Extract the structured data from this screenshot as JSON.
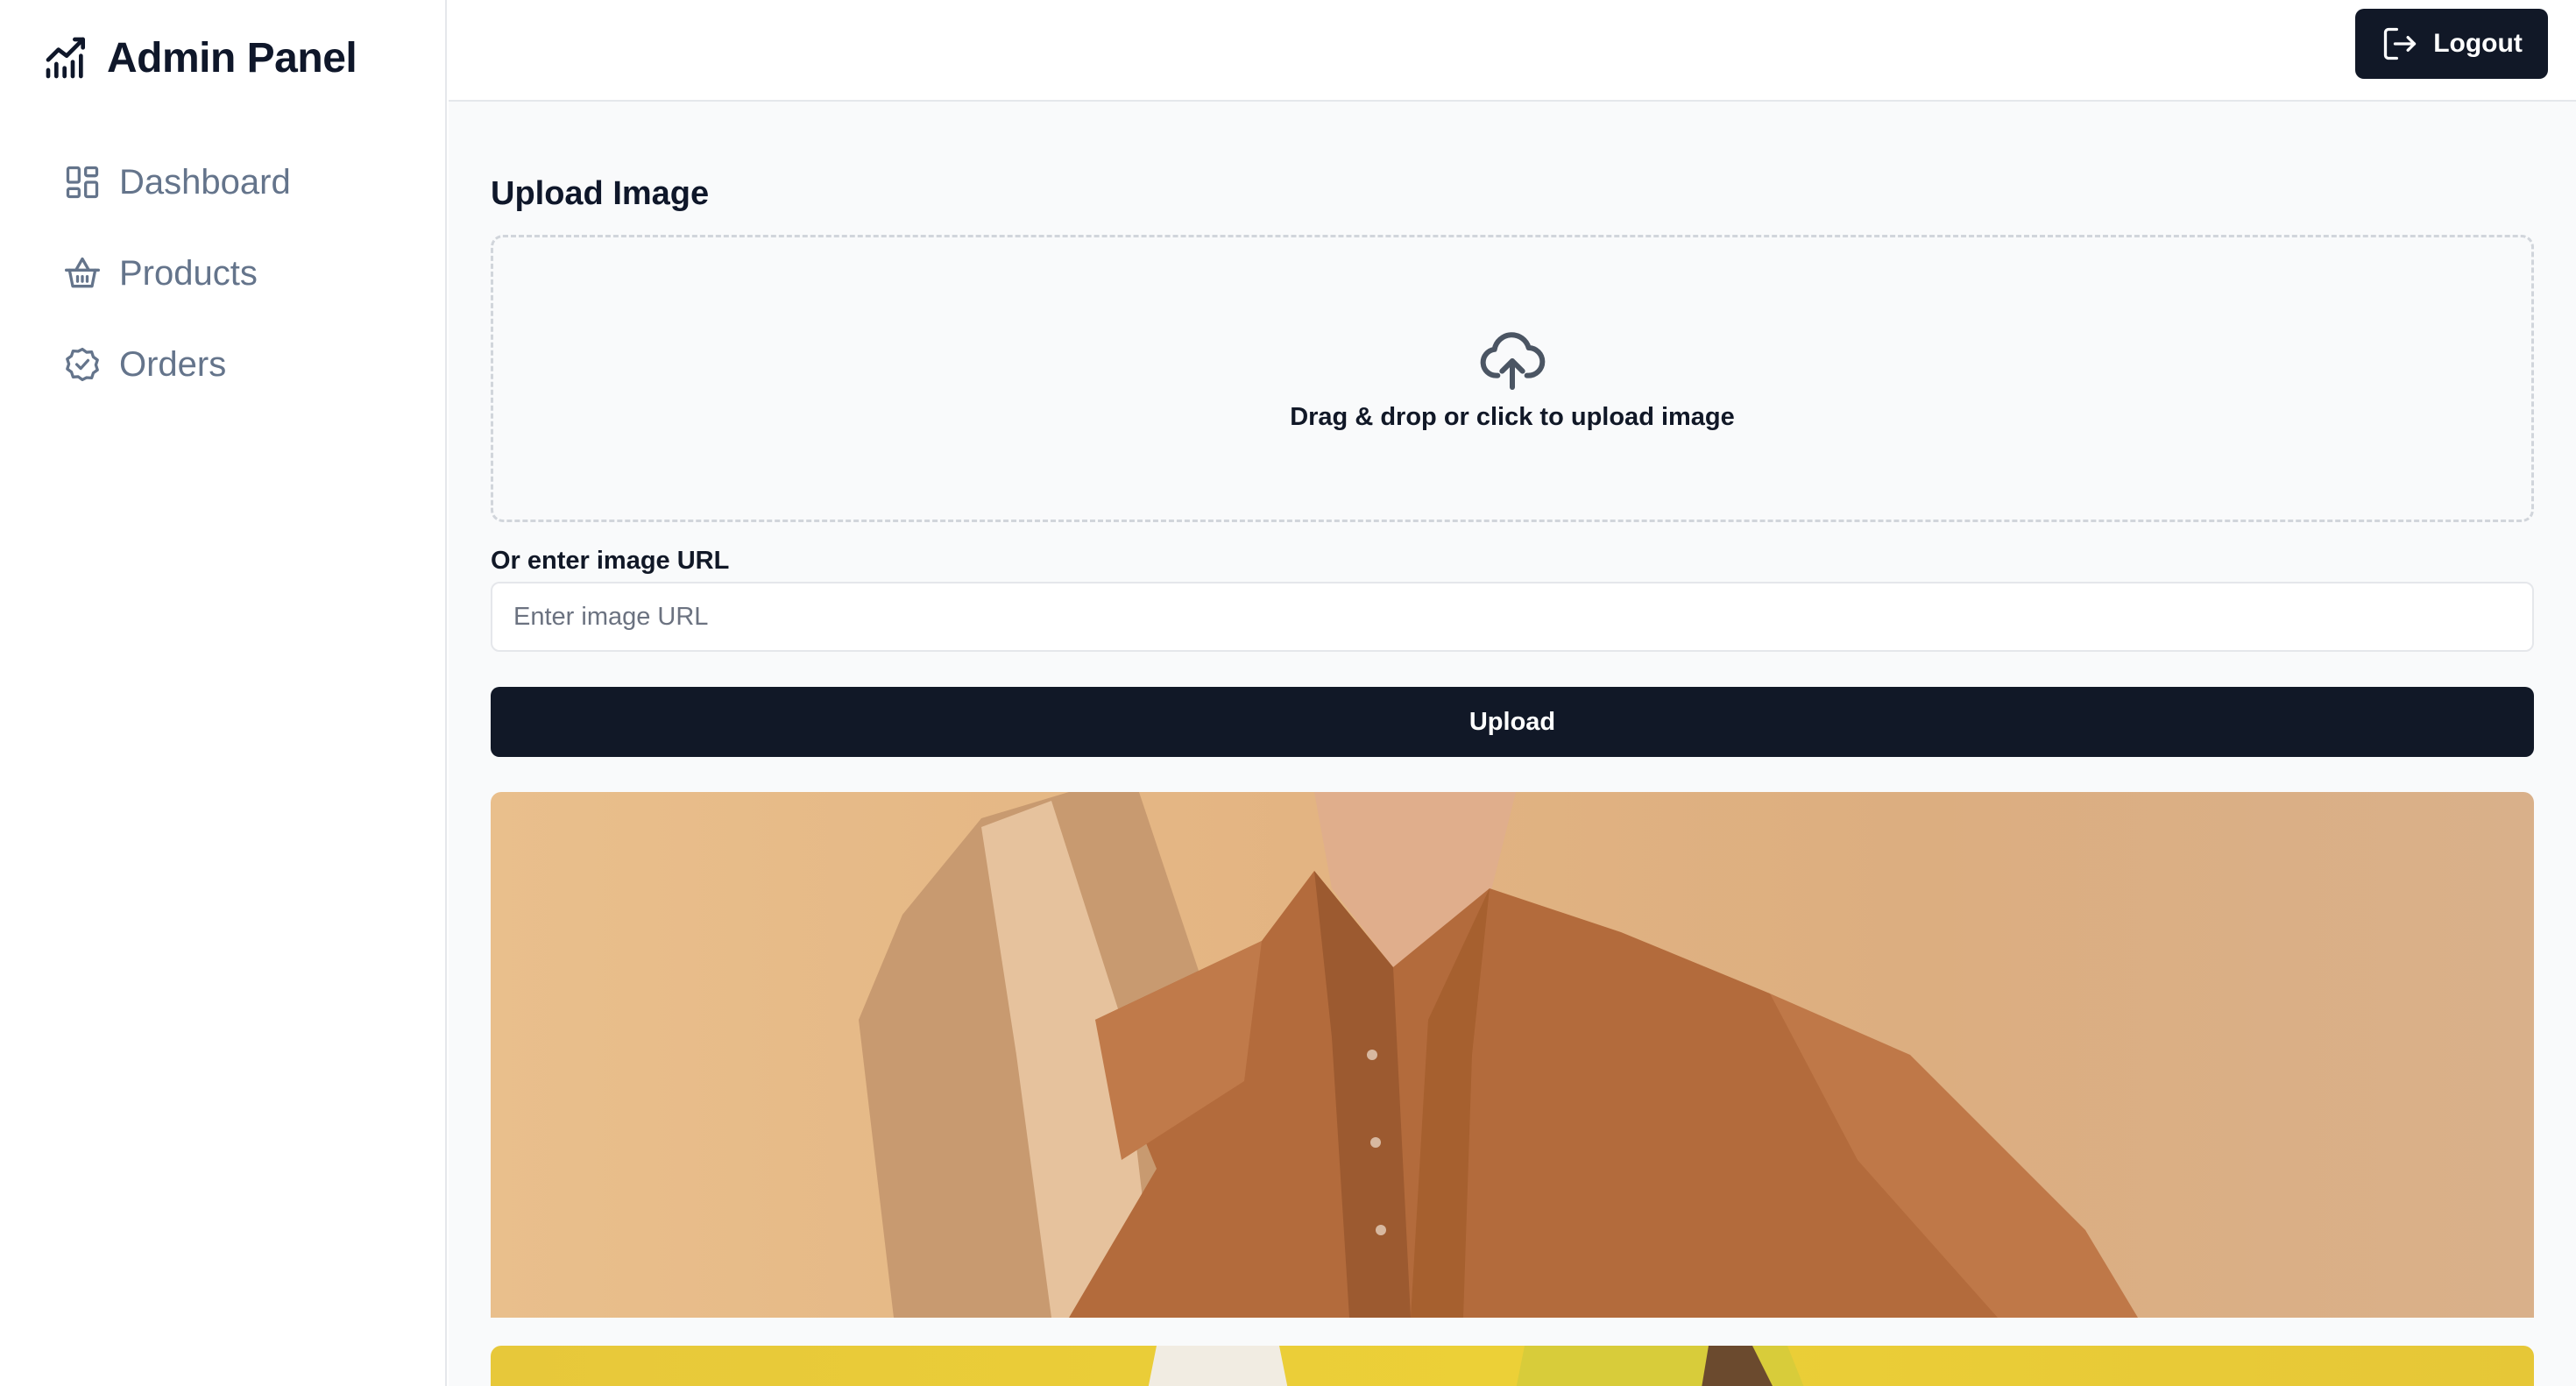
{
  "brand": {
    "title": "Admin Panel",
    "icon": "chart-bars-icon"
  },
  "sidebar": {
    "items": [
      {
        "label": "Dashboard",
        "icon": "dashboard-grid-icon"
      },
      {
        "label": "Products",
        "icon": "basket-icon"
      },
      {
        "label": "Orders",
        "icon": "badge-check-icon"
      }
    ]
  },
  "header": {
    "logout_label": "Logout",
    "logout_icon": "logout-icon"
  },
  "upload": {
    "title": "Upload Image",
    "dropzone_text": "Drag & drop or click to upload image",
    "dropzone_icon": "cloud-upload-icon",
    "url_label": "Or enter image URL",
    "url_placeholder": "Enter image URL",
    "url_value": "",
    "button_label": "Upload"
  },
  "images": [
    {
      "name": "man-in-brown-shirt-photo"
    },
    {
      "name": "yellow-background-photo"
    }
  ],
  "colors": {
    "primary": "#111827",
    "muted_text": "#64748b",
    "border": "#e5e7eb",
    "main_bg": "#f9fafb"
  }
}
